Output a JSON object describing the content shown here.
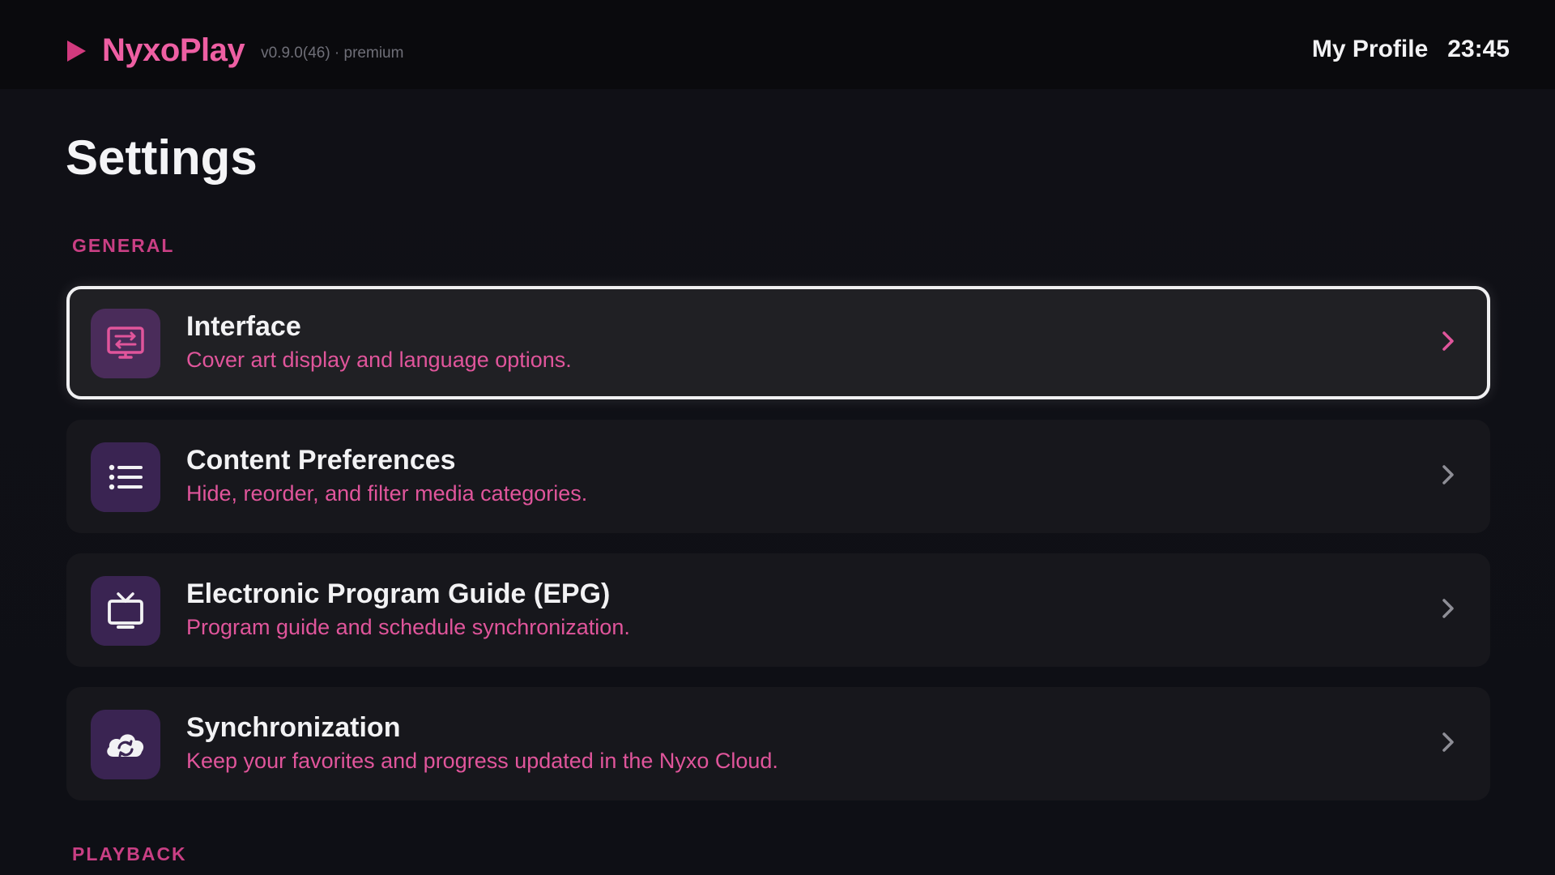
{
  "app": {
    "name": "NyxoPlay",
    "version": "v0.9.0(46) · premium",
    "logo_icon": "play-icon"
  },
  "header": {
    "profile_label": "My Profile",
    "time": "23:45"
  },
  "page": {
    "title": "Settings"
  },
  "sections": {
    "general_label": "GENERAL",
    "playback_label": "PLAYBACK"
  },
  "settings_items": [
    {
      "title": "Interface",
      "description": "Cover art display and language options.",
      "icon": "monitor-swap-icon",
      "selected": true
    },
    {
      "title": "Content Preferences",
      "description": "Hide, reorder, and filter media categories.",
      "icon": "list-icon",
      "selected": false
    },
    {
      "title": "Electronic Program Guide (EPG)",
      "description": "Program guide and schedule synchronization.",
      "icon": "tv-icon",
      "selected": false
    },
    {
      "title": "Synchronization",
      "description": "Keep your favorites and progress updated in the Nyxo Cloud.",
      "icon": "cloud-sync-icon",
      "selected": false
    }
  ],
  "colors": {
    "accent": "#e0559b",
    "brand": "#ee5fa3",
    "section_label": "#c93f84",
    "icon_tile": "#3a2452",
    "background": "#0e0f15"
  }
}
